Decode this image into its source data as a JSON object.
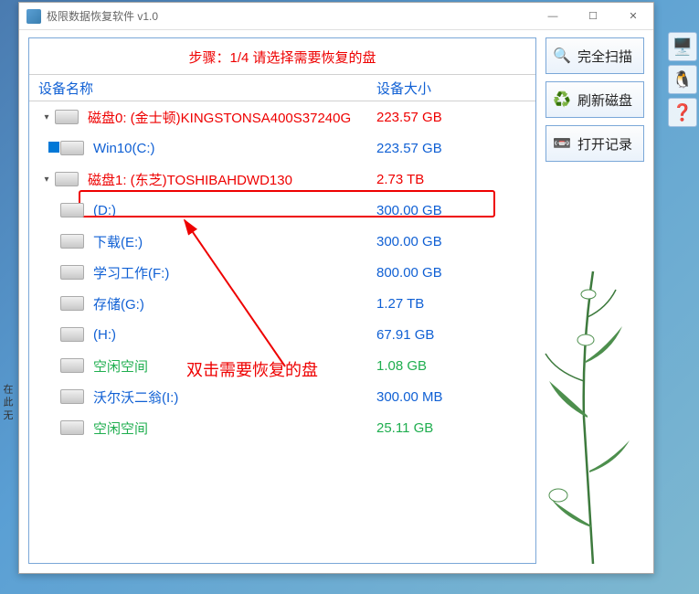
{
  "window": {
    "title": "极限数据恢复软件 v1.0"
  },
  "step_header": "步骤：1/4 请选择需要恢复的盘",
  "columns": {
    "name": "设备名称",
    "size": "设备大小"
  },
  "rows": [
    {
      "type": "disk",
      "label": "磁盘0: (金士顿)KINGSTONSA400S37240G",
      "size": "223.57 GB",
      "expanded": true,
      "indent": 0
    },
    {
      "type": "part",
      "label": "Win10(C:)",
      "size": "223.57 GB",
      "indent": 1,
      "win": true
    },
    {
      "type": "disk",
      "label": "磁盘1: (东芝)TOSHIBAHDWD130",
      "size": "2.73 TB",
      "expanded": true,
      "indent": 0
    },
    {
      "type": "part",
      "label": "(D:)",
      "size": "300.00 GB",
      "indent": 1,
      "selected": true
    },
    {
      "type": "part",
      "label": "下载(E:)",
      "size": "300.00 GB",
      "indent": 1
    },
    {
      "type": "part",
      "label": "学习工作(F:)",
      "size": "800.00 GB",
      "indent": 1
    },
    {
      "type": "part",
      "label": "存储(G:)",
      "size": "1.27 TB",
      "indent": 1
    },
    {
      "type": "part",
      "label": "(H:)",
      "size": "67.91 GB",
      "indent": 1
    },
    {
      "type": "free",
      "label": "空闲空间",
      "size": "1.08 GB",
      "indent": 1
    },
    {
      "type": "part",
      "label": "沃尔沃二翁(I:)",
      "size": "300.00 MB",
      "indent": 1
    },
    {
      "type": "free",
      "label": "空闲空间",
      "size": "25.11 GB",
      "indent": 1
    }
  ],
  "annotation": "双击需要恢复的盘",
  "buttons": {
    "scan": "完全扫描",
    "refresh": "刷新磁盘",
    "openlog": "打开记录"
  },
  "left_hint": "在 此 无"
}
